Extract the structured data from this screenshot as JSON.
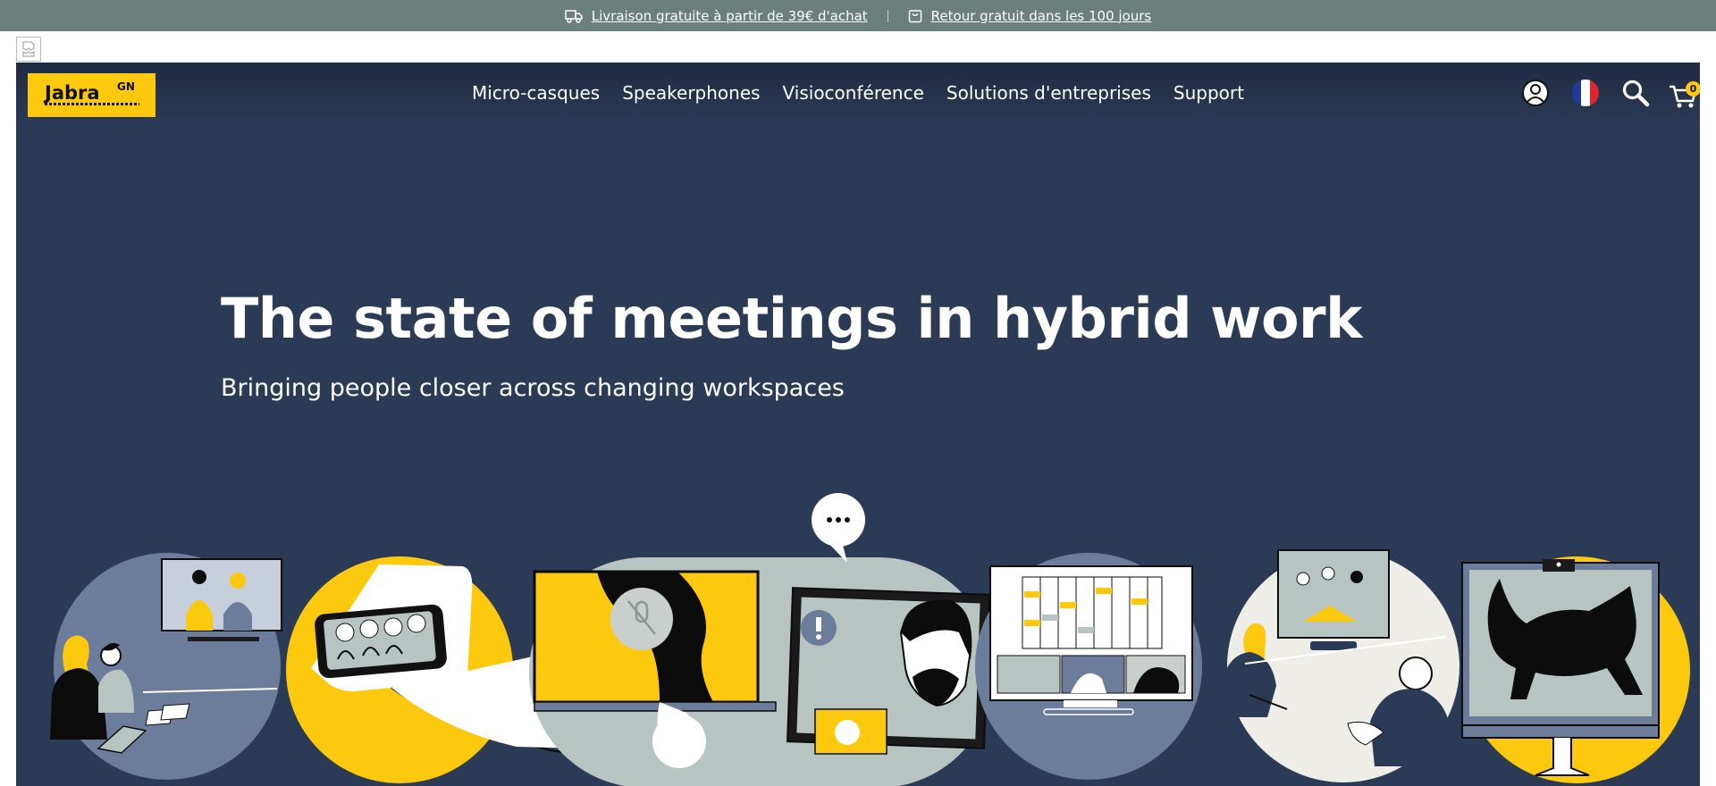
{
  "announcement": {
    "shipping_label": "Livraison gratuite à partir de 39€ d'achat",
    "returns_label": "Retour gratuit dans les 100 jours"
  },
  "header": {
    "logo_text": "Jabra",
    "logo_mark": "GN",
    "nav_items": [
      "Micro-casques",
      "Speakerphones",
      "Visioconférence",
      "Solutions d'entreprises",
      "Support"
    ],
    "icons": [
      "account-icon",
      "french-flag-icon",
      "search-icon",
      "cart-icon"
    ],
    "cart_count": "0"
  },
  "hero": {
    "title": "The state of meetings in hybrid work",
    "subtitle": "Bringing people closer across changing workspaces"
  },
  "colors": {
    "announcement_bg": "#6b7f7c",
    "hero_bg": "#2b3a55",
    "brand_yellow": "#fdc90f",
    "accent_slate": "#6c7d9c",
    "accent_sage": "#b7c4c1",
    "accent_cream": "#efede8"
  }
}
